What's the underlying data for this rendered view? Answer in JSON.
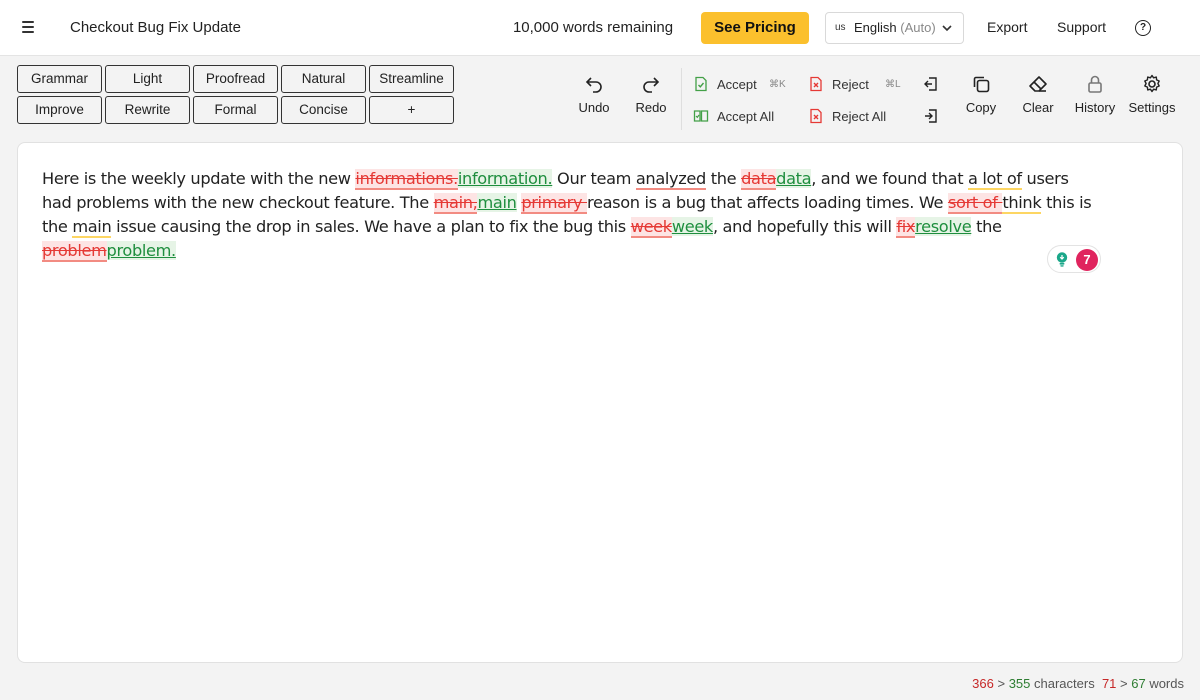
{
  "header": {
    "title": "Checkout Bug Fix Update",
    "words_remaining": "10,000 words remaining",
    "pricing_label": "See Pricing",
    "language_flag": "us",
    "language": "English",
    "language_mode": "(Auto)",
    "export_label": "Export",
    "support_label": "Support",
    "help_glyph": "?"
  },
  "modes": {
    "grammar": "Grammar",
    "light": "Light",
    "proofread": "Proofread",
    "natural": "Natural",
    "streamline": "Streamline",
    "improve": "Improve",
    "rewrite": "Rewrite",
    "formal": "Formal",
    "concise": "Concise",
    "add": "+"
  },
  "toolbar": {
    "undo": "Undo",
    "redo": "Redo",
    "accept": "Accept",
    "accept_shortcut": "⌘K",
    "reject": "Reject",
    "reject_shortcut": "⌘L",
    "accept_all": "Accept All",
    "reject_all": "Reject All",
    "copy": "Copy",
    "clear": "Clear",
    "history": "History",
    "settings": "Settings"
  },
  "document": {
    "s1_a": "Here is the weekly update with the new ",
    "del_informations": "informations.",
    "ins_information": "information.",
    "s1_b": " Our team ",
    "w_analyzed": "analyzed",
    "s1_c": " the ",
    "del_data": "data",
    "ins_data": "data",
    "s1_d": ", and we found that ",
    "w_alotof": "a lot of",
    "s1_e": " users had problems with the new checkout feature. The ",
    "del_main": "main,",
    "ins_main": "main",
    "s2_a": " ",
    "del_primary": "primary ",
    "s2_b": "reason is a bug that affects loading times. We ",
    "del_sortof": "sort of ",
    "w_think": "think",
    "s2_c": " this is the ",
    "w_main": "main",
    "s2_d": " issue causing the drop in sales. We have a plan to fix the bug this ",
    "del_week": "week",
    "ins_week": "week",
    "s3_a": ", and hopefully this will ",
    "del_fix": "fix",
    "ins_resolve": "resolve",
    "s3_b": " the ",
    "del_problem": "problem",
    "ins_problem": "problem."
  },
  "suggestions": {
    "count": "7"
  },
  "stats": {
    "chars_before": "366",
    "chars_sep": " > ",
    "chars_after": "355",
    "chars_label": " characters",
    "words_before": "71",
    "words_sep": " > ",
    "words_after": "67",
    "words_label": " words"
  },
  "colors": {
    "accent_yellow": "#fbc02d",
    "deletion": "#e53935",
    "insertion": "#1e8e3e",
    "badge": "#e0245e",
    "bulb": "#1aa789"
  }
}
